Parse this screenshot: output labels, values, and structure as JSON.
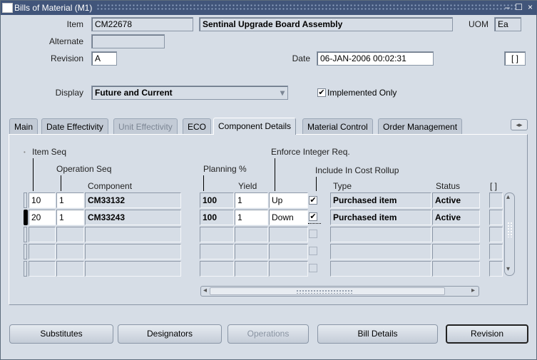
{
  "window": {
    "title": "Bills of Material (M1)"
  },
  "header": {
    "item_label": "Item",
    "item_value": "CM22678",
    "item_description": "Sentinal Upgrade Board Assembly",
    "uom_label": "UOM",
    "uom_value": "Ea",
    "alternate_label": "Alternate",
    "alternate_value": "",
    "revision_label": "Revision",
    "revision_value": "A",
    "date_label": "Date",
    "date_value": "06-JAN-2006 00:02:31",
    "flex_field": "[ ]",
    "display_label": "Display",
    "display_value": "Future and Current",
    "implemented_only_label": "Implemented Only",
    "implemented_only_checked": true
  },
  "tabs": [
    {
      "label": "Main",
      "state": "normal"
    },
    {
      "label": "Date Effectivity",
      "state": "normal"
    },
    {
      "label": "Unit Effectivity",
      "state": "disabled"
    },
    {
      "label": "ECO",
      "state": "normal"
    },
    {
      "label": "Component Details",
      "state": "active"
    },
    {
      "label": "Material Control",
      "state": "normal"
    },
    {
      "label": "Order Management",
      "state": "normal"
    }
  ],
  "grid": {
    "headers": {
      "item_seq": "Item Seq",
      "operation_seq": "Operation Seq",
      "component": "Component",
      "planning_pct": "Planning %",
      "yield": "Yield",
      "enforce_integer": "Enforce Integer Req.",
      "include_in_cost_rollup": "Include In Cost Rollup",
      "type": "Type",
      "status": "Status",
      "flex": "[ ]"
    },
    "rows": [
      {
        "item_seq": "10",
        "op_seq": "1",
        "component": "CM33132",
        "planning": "100",
        "yield": "1",
        "enforce": "Up",
        "cost_rollup": true,
        "type": "Purchased item",
        "status": "Active"
      },
      {
        "item_seq": "20",
        "op_seq": "1",
        "component": "CM33243",
        "planning": "100",
        "yield": "1",
        "enforce": "Down",
        "cost_rollup": true,
        "type": "Purchased item",
        "status": "Active"
      },
      {
        "item_seq": "",
        "op_seq": "",
        "component": "",
        "planning": "",
        "yield": "",
        "enforce": "",
        "cost_rollup": false,
        "type": "",
        "status": ""
      },
      {
        "item_seq": "",
        "op_seq": "",
        "component": "",
        "planning": "",
        "yield": "",
        "enforce": "",
        "cost_rollup": false,
        "type": "",
        "status": ""
      },
      {
        "item_seq": "",
        "op_seq": "",
        "component": "",
        "planning": "",
        "yield": "",
        "enforce": "",
        "cost_rollup": false,
        "type": "",
        "status": ""
      }
    ]
  },
  "buttons": {
    "substitutes": "Substitutes",
    "designators": "Designators",
    "operations": "Operations",
    "bill_details": "Bill Details",
    "revision": "Revision"
  },
  "icons": {
    "check": "✔",
    "tab_scroll": "◂▸",
    "scroll_up": "▴",
    "scroll_down": "▾",
    "scroll_left": "◂",
    "scroll_right": "▸",
    "dropdown": "▾",
    "minimize": "–",
    "maximize": "☐",
    "close": "×"
  },
  "colors": {
    "titlebar": "#41557a",
    "background": "#d6dde6"
  }
}
